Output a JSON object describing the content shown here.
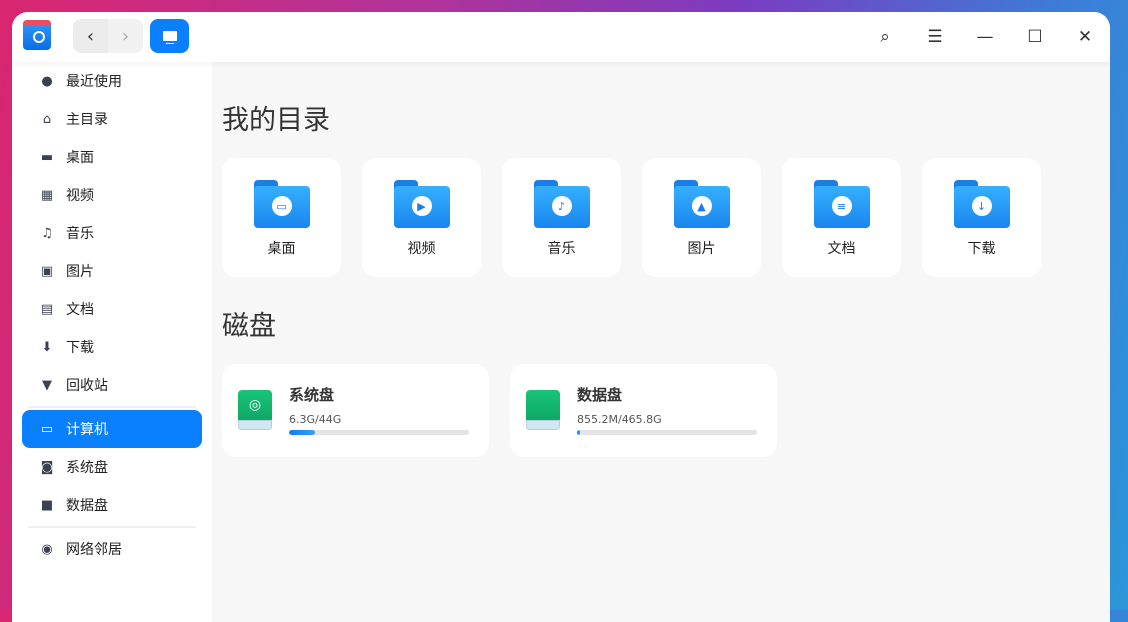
{
  "sidebar": {
    "items": [
      {
        "label": "最近使用",
        "icon": "clock-icon"
      },
      {
        "label": "主目录",
        "icon": "home-icon"
      },
      {
        "label": "桌面",
        "icon": "desktop-icon"
      },
      {
        "label": "视频",
        "icon": "video-icon"
      },
      {
        "label": "音乐",
        "icon": "music-icon"
      },
      {
        "label": "图片",
        "icon": "picture-icon"
      },
      {
        "label": "文档",
        "icon": "document-icon"
      },
      {
        "label": "下载",
        "icon": "download-icon"
      },
      {
        "label": "回收站",
        "icon": "trash-icon"
      },
      {
        "label": "计算机",
        "icon": "computer-icon"
      },
      {
        "label": "系统盘",
        "icon": "disk-icon"
      },
      {
        "label": "数据盘",
        "icon": "disk-icon"
      },
      {
        "label": "网络邻居",
        "icon": "network-icon"
      }
    ]
  },
  "main": {
    "my_dirs_title": "我的目录",
    "disks_title": "磁盘",
    "folders": [
      {
        "label": "桌面"
      },
      {
        "label": "视频"
      },
      {
        "label": "音乐"
      },
      {
        "label": "图片"
      },
      {
        "label": "文档"
      },
      {
        "label": "下载"
      }
    ],
    "disks": [
      {
        "name": "系统盘",
        "size": "6.3G/44G",
        "used_percent": 14.3
      },
      {
        "name": "数据盘",
        "size": "855.2M/465.8G",
        "used_percent": 0.2
      }
    ]
  },
  "colors": {
    "accent": "#0a80ff",
    "disk": "#10b26c"
  }
}
